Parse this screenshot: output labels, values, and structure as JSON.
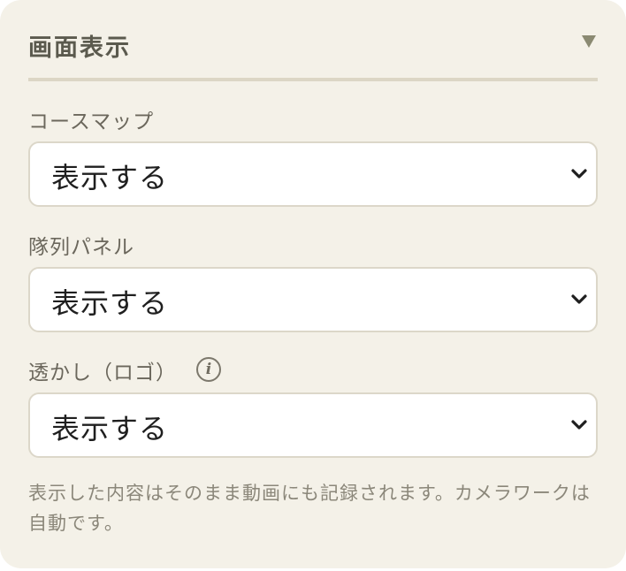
{
  "panel": {
    "title": "画面表示",
    "collapse_icon": "triangle-down-icon"
  },
  "fields": [
    {
      "label": "コースマップ",
      "value": "表示する"
    },
    {
      "label": "隊列パネル",
      "value": "表示する"
    },
    {
      "label": "透かし（ロゴ）",
      "value": "表示する",
      "info_icon": "i"
    }
  ],
  "note": "表示した内容はそのまま動画にも記録されます。カメラワークは自動です。",
  "colors": {
    "panel_bg": "#f4f1e8",
    "title": "#5b5a4e",
    "divider": "#dcd6c5",
    "select_bg": "#ffffff",
    "note_text": "#8b877a"
  }
}
